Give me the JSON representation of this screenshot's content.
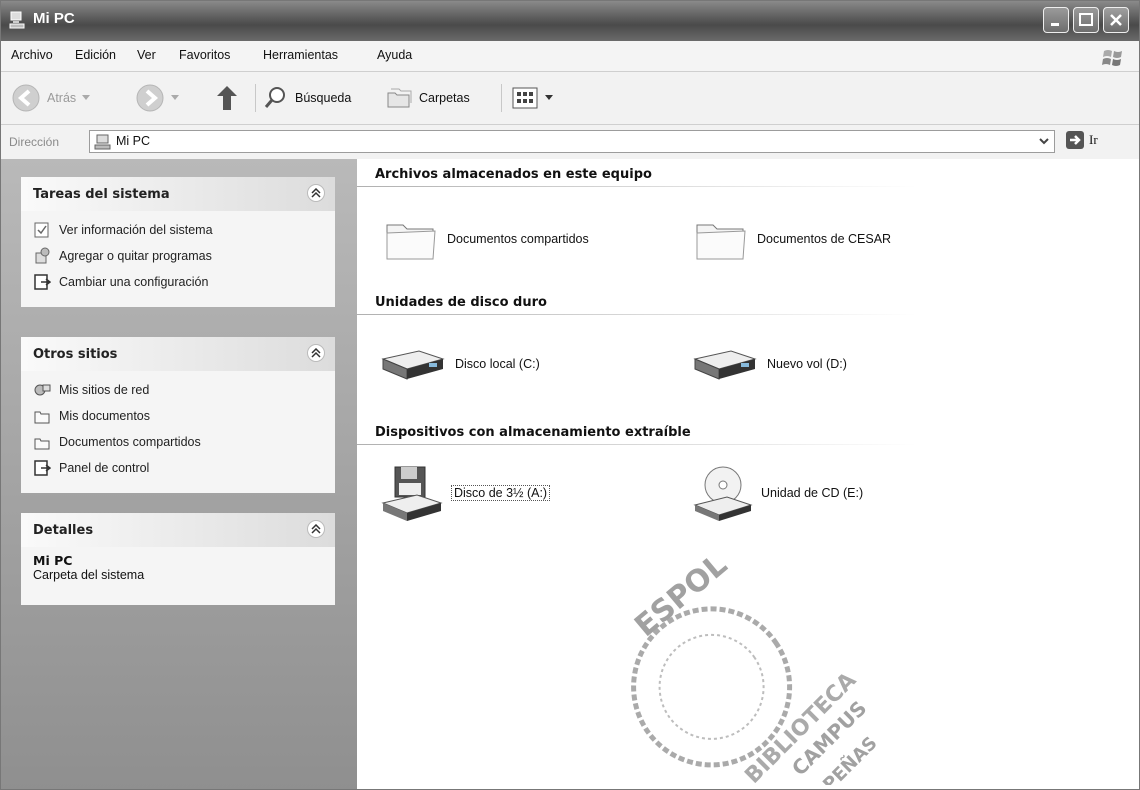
{
  "window": {
    "title": "Mi PC"
  },
  "menu": [
    "Archivo",
    "Edición",
    "Ver",
    "Favoritos",
    "Herramientas",
    "Ayuda"
  ],
  "toolbar": {
    "back": "Atrás",
    "search": "Búsqueda",
    "folders": "Carpetas"
  },
  "address": {
    "label": "Dirección",
    "value": "Mi PC",
    "go": "Ir"
  },
  "tasks_panel": {
    "title": "Tareas del sistema",
    "items": [
      "Ver información del sistema",
      "Agregar o quitar programas",
      "Cambiar una configuración"
    ]
  },
  "places_panel": {
    "title": "Otros sitios",
    "items": [
      "Mis sitios de red",
      "Mis documentos",
      "Documentos compartidos",
      "Panel de control"
    ]
  },
  "details_panel": {
    "title": "Detalles",
    "name": "Mi PC",
    "type": "Carpeta del sistema"
  },
  "groups": [
    {
      "title": "Archivos almacenados en este equipo",
      "items": [
        {
          "label": "Documentos compartidos",
          "icon": "folder-icon"
        },
        {
          "label": "Documentos de CESAR",
          "icon": "folder-icon"
        }
      ]
    },
    {
      "title": "Unidades de disco duro",
      "items": [
        {
          "label": "Disco local (C:)",
          "icon": "hard-drive-icon"
        },
        {
          "label": "Nuevo vol (D:)",
          "icon": "hard-drive-icon"
        }
      ]
    },
    {
      "title": "Dispositivos con almacenamiento extraíble",
      "items": [
        {
          "label": "Disco de 3½ (A:)",
          "icon": "floppy-drive-icon"
        },
        {
          "label": "Unidad de CD (E:)",
          "icon": "cd-drive-icon"
        }
      ]
    }
  ],
  "stamp": {
    "text": [
      "ESPOL",
      "BIBLIOTECA",
      "CAMPUS",
      "PEÑAS"
    ]
  }
}
